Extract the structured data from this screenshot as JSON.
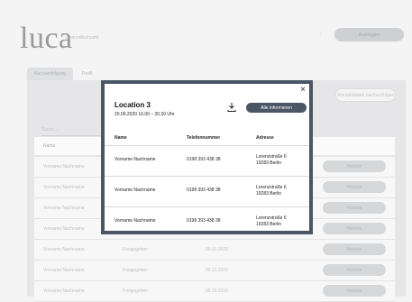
{
  "app": {
    "logo": "luca",
    "logo_sub": "Gesundheitsamt",
    "menu_dot": ":",
    "logout_label": "Ausloggen"
  },
  "tabs": [
    {
      "label": "Nachverfolgung"
    },
    {
      "label": "Profil"
    }
  ],
  "panel": {
    "search_placeholder": "Suche ...",
    "request_button": "Kontaktdaten nachverfolgen",
    "table_header_name": "Name",
    "rows": [
      {
        "name": "Vorname Nachname",
        "status": "",
        "date": "",
        "history": "Historie"
      },
      {
        "name": "Vorname Nachname",
        "status": "",
        "date": "",
        "history": "Historie"
      },
      {
        "name": "Vorname Nachname",
        "status": "",
        "date": "",
        "history": "Historie"
      },
      {
        "name": "Vorname Nachname",
        "status": "",
        "date": "",
        "history": "Historie"
      },
      {
        "name": "Vorname Nachname",
        "status": "Freigegeben",
        "date": "09.10.2020",
        "history": "Historie"
      },
      {
        "name": "Vorname Nachname",
        "status": "Freigegeben",
        "date": "09.10.2020",
        "history": "Historie"
      },
      {
        "name": "Vorname Nachname",
        "status": "Freigegeben",
        "date": "09.10.2020",
        "history": "Historie"
      }
    ]
  },
  "modal": {
    "title": "Location 3",
    "time": "20.09.2020 16.00 – 20.30 Uhr",
    "inform_button": "Alle informieren",
    "close_symbol": "×",
    "headers": {
      "name": "Name",
      "phone": "Telefonnummer",
      "address": "Adresse"
    },
    "rows": [
      {
        "name": "Vorname Nachname",
        "phone": "0198 393 438 38",
        "street": "Lorenzstraße 6",
        "city": "19283 Berlin"
      },
      {
        "name": "Vorname Nachname",
        "phone": "0198 393 438 38",
        "street": "Lorenzstraße 6",
        "city": "19283 Berlin"
      },
      {
        "name": "Vorname Nachname",
        "phone": "0198 393 438 38",
        "street": "Lorenzstraße 6",
        "city": "19283 Berlin"
      }
    ]
  },
  "colors": {
    "modal_border": "#4a5565",
    "accent_button": "#4a5565",
    "background": "#f4f4f4"
  },
  "icons": {
    "download": "download-icon",
    "close": "close-icon"
  }
}
